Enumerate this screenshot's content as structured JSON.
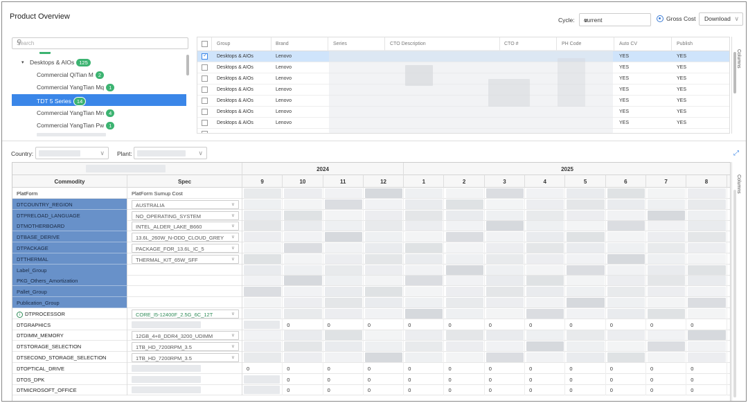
{
  "header": {
    "title": "Product Overview",
    "cycle_label": "Cycle:",
    "cycle_value": "current",
    "gross_cost_label": "Gross Cost",
    "download_label": "Download"
  },
  "tree": {
    "search_placeholder": "Search",
    "items": [
      {
        "label": "Desktops & AIOs",
        "count": "125"
      },
      {
        "label": "Commercial QiTian M",
        "count": "2"
      },
      {
        "label": "Commercial YangTian Mq",
        "count": "1"
      },
      {
        "label": "TDT 5 Series",
        "count": "14"
      },
      {
        "label": "Commercial YangTian Mn",
        "count": "4"
      },
      {
        "label": "Commercial YangTian Pw",
        "count": "1"
      }
    ]
  },
  "product_grid": {
    "columns": [
      "Group",
      "Brand",
      "Series",
      "CTO Description",
      "CTO #",
      "PH Code",
      "Auto CV",
      "Publish"
    ],
    "rows": [
      {
        "group": "Desktops & AIOs",
        "brand": "Lenovo",
        "auto_cv": "YES",
        "publish": "YES"
      },
      {
        "group": "Desktops & AIOs",
        "brand": "Lenovo",
        "auto_cv": "YES",
        "publish": "YES"
      },
      {
        "group": "Desktops & AIOs",
        "brand": "Lenovo",
        "auto_cv": "YES",
        "publish": "YES"
      },
      {
        "group": "Desktops & AIOs",
        "brand": "Lenovo",
        "auto_cv": "YES",
        "publish": "YES"
      },
      {
        "group": "Desktops & AIOs",
        "brand": "Lenovo",
        "auto_cv": "YES",
        "publish": "YES"
      },
      {
        "group": "Desktops & AIOs",
        "brand": "Lenovo",
        "auto_cv": "YES",
        "publish": "YES"
      },
      {
        "group": "Desktops & AIOs",
        "brand": "Lenovo",
        "auto_cv": "YES",
        "publish": "YES"
      }
    ],
    "side_label": "Columns"
  },
  "filters": {
    "country_label": "Country:",
    "plant_label": "Plant:"
  },
  "cost_grid": {
    "year_2024": "2024",
    "year_2025": "2025",
    "col_commodity": "Commodity",
    "col_spec": "Spec",
    "months": [
      "9",
      "10",
      "11",
      "12",
      "1",
      "2",
      "3",
      "4",
      "5",
      "6",
      "7",
      "8"
    ],
    "rows": [
      {
        "commodity": "PlatForm",
        "spec": "PlatForm Sumup Cost",
        "style": "plain",
        "select": false
      },
      {
        "commodity": "DTCOUNTRY_REGION",
        "spec": "AUSTRALIA",
        "style": "blue",
        "select": true
      },
      {
        "commodity": "DTPRELOAD_LANGUAGE",
        "spec": "NO_OPERATING_SYSTEM",
        "style": "blue",
        "select": true
      },
      {
        "commodity": "DTMOTHERBOARD",
        "spec": "INTEL_ALDER_LAKE_B660",
        "style": "blue",
        "select": true
      },
      {
        "commodity": "DTBASE_DERIVE",
        "spec": "13.6L_260W_N-ODD_CLOUD_GREY",
        "style": "blue",
        "select": true
      },
      {
        "commodity": "DTPACKAGE",
        "spec": "PACKAGE_FOR_13.6L_IC_5",
        "style": "blue",
        "select": true
      },
      {
        "commodity": "DTTHERMAL",
        "spec": "THERMAL_KIT_65W_SFF",
        "style": "blue",
        "select": true
      },
      {
        "commodity": "Label_Group",
        "spec": "",
        "style": "blue",
        "select": false
      },
      {
        "commodity": "PKG_Others_Amortization",
        "spec": "",
        "style": "blue",
        "select": false
      },
      {
        "commodity": "Pallet_Group",
        "spec": "",
        "style": "blue",
        "select": false
      },
      {
        "commodity": "Publication_Group",
        "spec": "",
        "style": "blue",
        "select": false
      },
      {
        "commodity": "DTPROCESSOR",
        "spec": "CORE_I5-12400F_2.5G_6C_12T",
        "style": "info",
        "select": true
      },
      {
        "commodity": "DTGRAPHICS",
        "spec": "",
        "style": "plain",
        "select": false,
        "values": [
          "",
          "0",
          "0",
          "0",
          "0",
          "0",
          "0",
          "0",
          "0",
          "0",
          "0",
          "0"
        ]
      },
      {
        "commodity": "DTDIMM_MEMORY",
        "spec": "12GB_4+8_DDR4_3200_UDIMM",
        "style": "plain",
        "select": true
      },
      {
        "commodity": "DTSTORAGE_SELECTION",
        "spec": "1TB_HD_7200RPM_3.5",
        "style": "plain",
        "select": true
      },
      {
        "commodity": "DTSECOND_STORAGE_SELECTION",
        "spec": "1TB_HD_7200RPM_3.5",
        "style": "plain",
        "select": true
      },
      {
        "commodity": "DTOPTICAL_DRIVE",
        "spec": "",
        "style": "plain",
        "select": false,
        "values": [
          "0",
          "0",
          "0",
          "0",
          "0",
          "0",
          "0",
          "0",
          "0",
          "0",
          "0",
          "0"
        ]
      },
      {
        "commodity": "DTOS_DPK",
        "spec": "",
        "style": "plain",
        "select": false,
        "values": [
          "",
          "0",
          "0",
          "0",
          "0",
          "0",
          "0",
          "0",
          "0",
          "0",
          "0",
          "0"
        ]
      },
      {
        "commodity": "DTMICROSOFT_OFFICE",
        "spec": "",
        "style": "plain",
        "select": false,
        "values": [
          "",
          "0",
          "0",
          "0",
          "0",
          "0",
          "0",
          "0",
          "0",
          "0",
          "0",
          "0"
        ]
      }
    ],
    "side_label": "Columns"
  },
  "colors": {
    "accent": "#3a86e8",
    "badge": "#3cb371",
    "commodity_highlight": "#6891c9",
    "selected_row": "#cfe4fb"
  }
}
